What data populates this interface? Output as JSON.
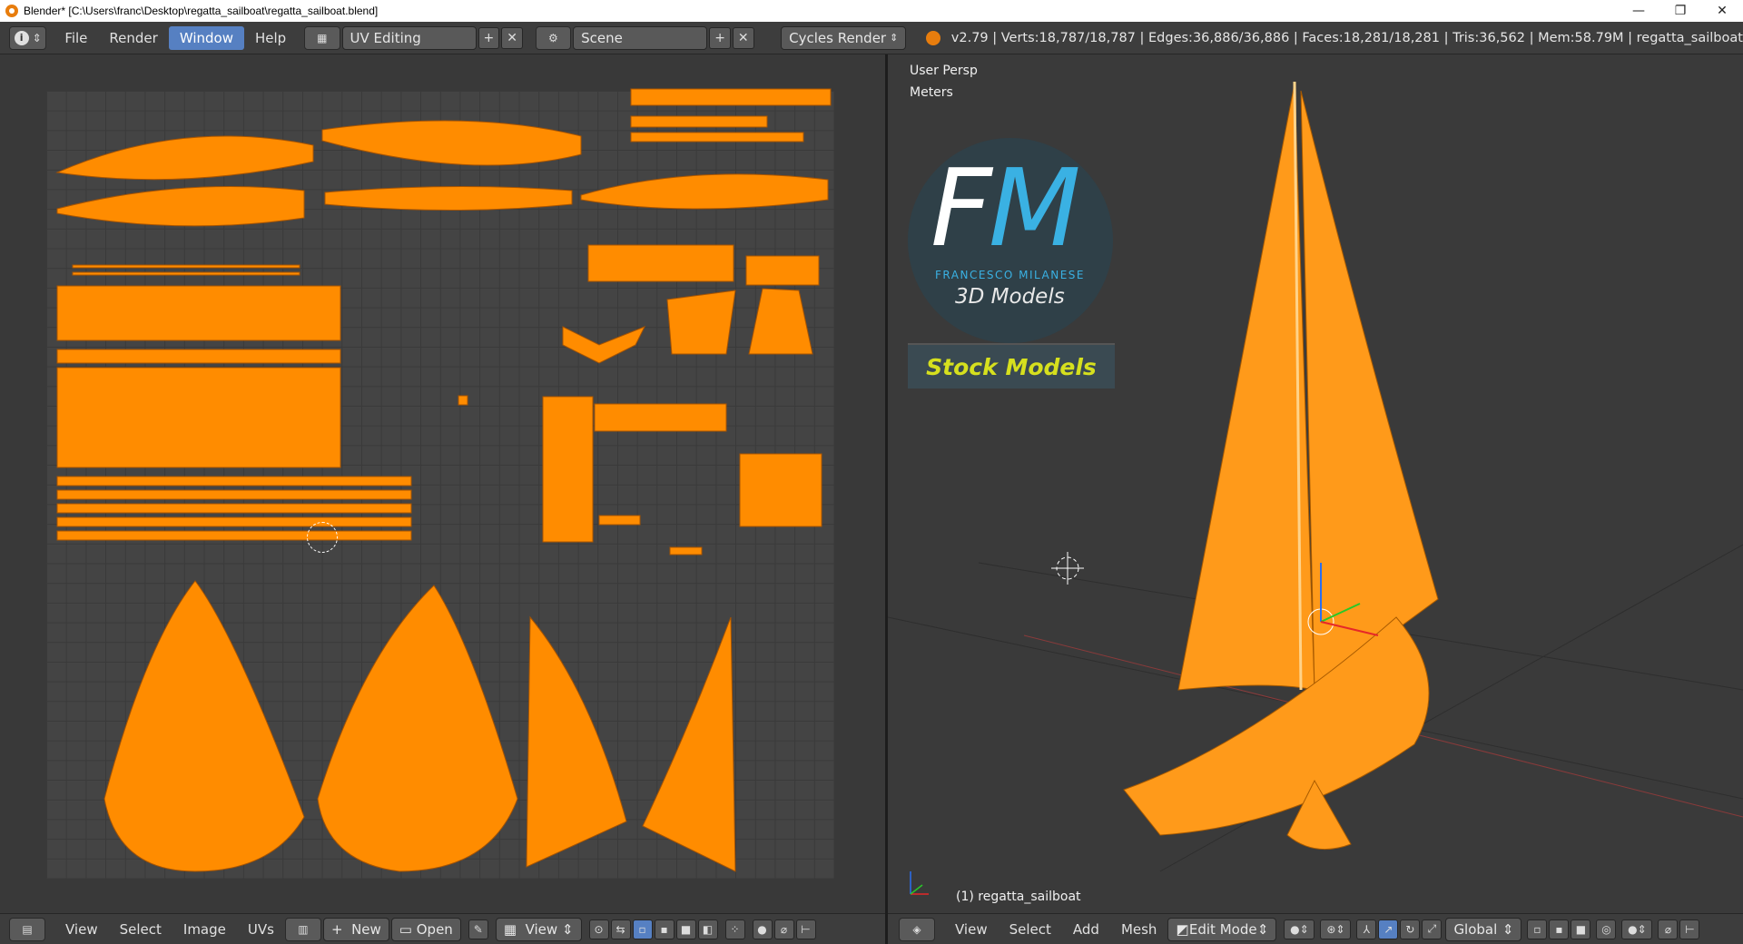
{
  "window": {
    "title": "Blender* [C:\\Users\\franc\\Desktop\\regatta_sailboat\\regatta_sailboat.blend]",
    "minimize": "—",
    "restore": "❐",
    "close": "✕"
  },
  "topbar": {
    "info_icon": "i",
    "menus": [
      "File",
      "Render",
      "Window",
      "Help"
    ],
    "active_menu": "Window",
    "layout_name": "UV Editing",
    "scene_name": "Scene",
    "render_engine": "Cycles Render",
    "stats": "v2.79 | Verts:18,787/18,787 | Edges:36,886/36,886 | Faces:18,281/18,281 | Tris:36,562 | Mem:58.79M | regatta_sailboat"
  },
  "viewport": {
    "view_name": "User Persp",
    "units": "Meters",
    "object_label": "(1) regatta_sailboat"
  },
  "logo": {
    "f": "F",
    "m": "M",
    "subtitle": "FRANCESCO MILANESE",
    "tagline": "3D Models",
    "banner": "Stock Models"
  },
  "uv_footer": {
    "menus": [
      "View",
      "Select",
      "Image",
      "UVs"
    ],
    "new_label": "New",
    "open_label": "Open",
    "view_label": "View"
  },
  "viewport_footer": {
    "menus": [
      "View",
      "Select",
      "Add",
      "Mesh"
    ],
    "mode": "Edit Mode",
    "orientation": "Global"
  },
  "colors": {
    "wire": "#ff8c00",
    "accent": "#5680c2"
  }
}
